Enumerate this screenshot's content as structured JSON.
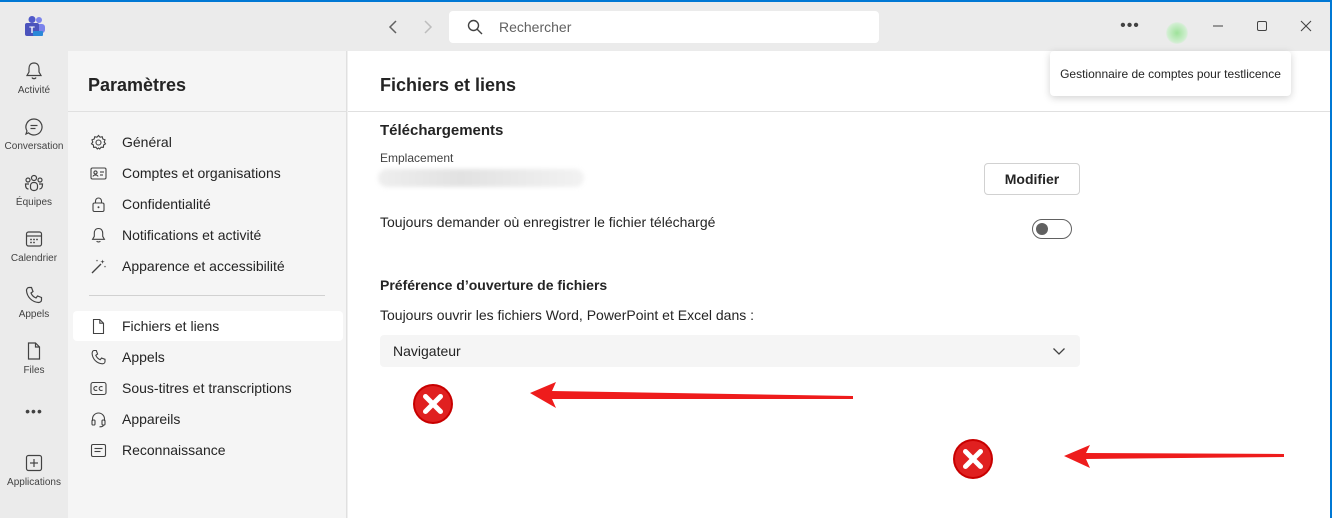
{
  "titlebar": {
    "search_placeholder": "Rechercher",
    "more_label": "•••",
    "tooltip": "Gestionnaire de comptes pour testlicence"
  },
  "rail": {
    "items": [
      {
        "label": "Activité",
        "icon": "bell-icon"
      },
      {
        "label": "Conversation",
        "icon": "chat-icon"
      },
      {
        "label": "Équipes",
        "icon": "teams-icon"
      },
      {
        "label": "Calendrier",
        "icon": "calendar-icon"
      },
      {
        "label": "Appels",
        "icon": "phone-icon"
      },
      {
        "label": "Files",
        "icon": "file-icon"
      },
      {
        "label": "•••",
        "icon": "more-icon"
      },
      {
        "label": "Applications",
        "icon": "add-apps-icon"
      }
    ]
  },
  "settings": {
    "title": "Paramètres",
    "items": [
      {
        "label": "Général",
        "icon": "gear-icon"
      },
      {
        "label": "Comptes et organisations",
        "icon": "id-card-icon"
      },
      {
        "label": "Confidentialité",
        "icon": "lock-icon"
      },
      {
        "label": "Notifications et activité",
        "icon": "bell-icon"
      },
      {
        "label": "Apparence et accessibilité",
        "icon": "magic-wand-icon"
      },
      {
        "label": "Fichiers et liens",
        "icon": "document-icon",
        "active": true
      },
      {
        "label": "Appels",
        "icon": "phone-icon"
      },
      {
        "label": "Sous-titres et transcriptions",
        "icon": "closed-caption-icon"
      },
      {
        "label": "Appareils",
        "icon": "headset-icon"
      },
      {
        "label": "Reconnaissance",
        "icon": "feedback-icon"
      }
    ]
  },
  "main": {
    "title": "Fichiers et liens",
    "downloads_heading": "Téléchargements",
    "location_label": "Emplacement",
    "modify_button": "Modifier",
    "ask_label": "Toujours demander où enregistrer le fichier téléchargé",
    "ask_toggle_on": false,
    "open_pref_heading": "Préférence d’ouverture de fichiers",
    "open_label": "Toujours ouvrir les fichiers Word, PowerPoint et Excel dans :",
    "open_value": "Navigateur"
  },
  "colors": {
    "accent": "#0078d4",
    "annotation_red": "#e02020"
  }
}
